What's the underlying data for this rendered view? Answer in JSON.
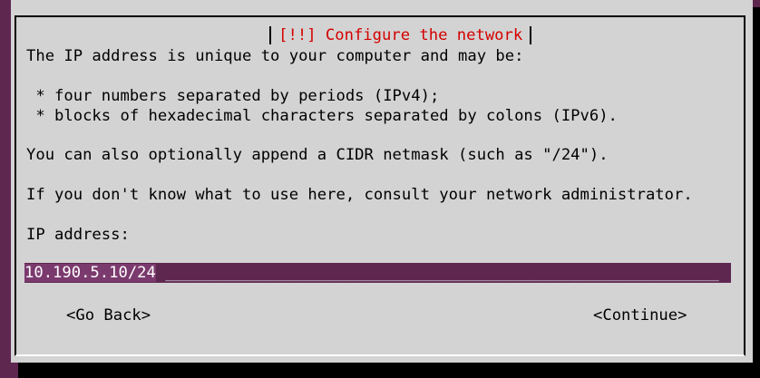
{
  "dialog": {
    "title": "[!!] Configure the network",
    "intro": "The IP address is unique to your computer and may be:",
    "bullets": [
      " * four numbers separated by periods (IPv4);",
      " * blocks of hexadecimal characters separated by colons (IPv6)."
    ],
    "cidr_note": "You can also optionally append a CIDR netmask (such as \"/24\").",
    "help_note": "If you don't know what to use here, consult your network administrator.",
    "field_label": "IP address:",
    "field_value": "10.190.5.10/24",
    "field_fill": "___________________________________________________________",
    "go_back_label": "<Go Back>",
    "continue_label": "<Continue>"
  },
  "colors": {
    "background": "#5e2750",
    "dialog": "#d3d3d3",
    "title": "#d40000"
  }
}
